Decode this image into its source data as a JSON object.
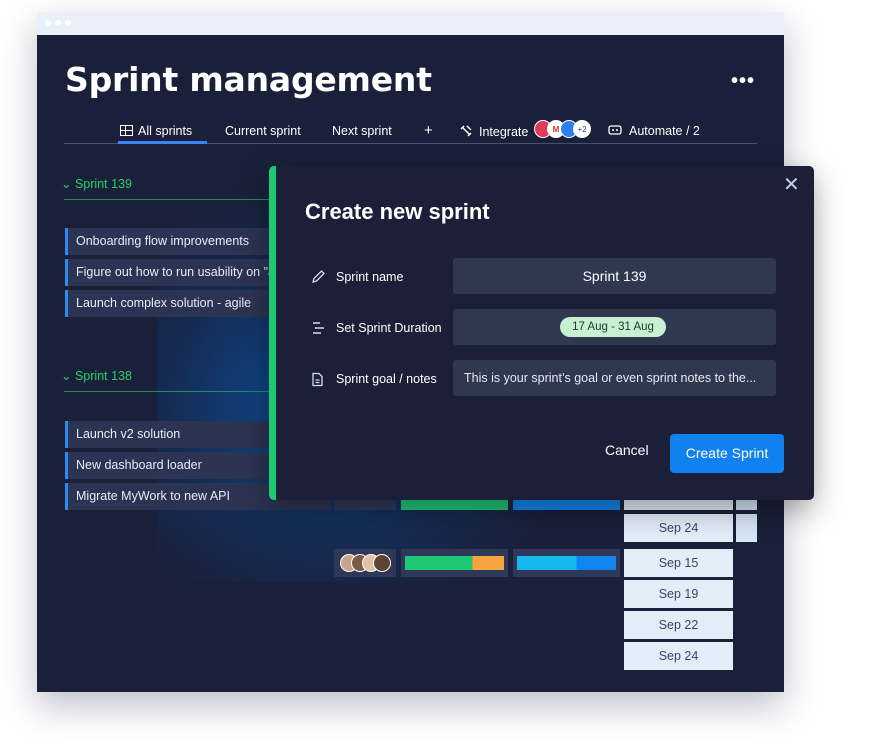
{
  "page": {
    "title": "Sprint management",
    "more_icon": "more-horizontal-icon"
  },
  "tabs": {
    "all_sprints": "All sprints",
    "current_sprint": "Current sprint",
    "next_sprint": "Next sprint",
    "add": "+",
    "integrate": "Integrate",
    "integrate_more": "+2",
    "automate": "Automate / 2"
  },
  "groups": [
    {
      "title": "Sprint 139",
      "color": "#23d06f",
      "tasks": [
        "Onboarding flow improvements",
        "Figure out how to run usability on \"a",
        "Launch complex solution - agile"
      ]
    },
    {
      "title": "Sprint 138",
      "color": "#23d06f",
      "tasks": [
        "Launch v2 solution",
        "New dashboard loader",
        "Migrate MyWork to new API"
      ]
    }
  ],
  "dates_column": {
    "group2_partial": [
      "Sep 24"
    ],
    "group3": [
      "Sep 15",
      "Sep 19",
      "Sep 22",
      "Sep 24"
    ]
  },
  "progress": [
    {
      "status_fill": 0.68,
      "status_colors": [
        "#1ec874",
        "#f7a440"
      ],
      "timeline_fill": 0.6,
      "timeline_colors": [
        "#15b9ee",
        "#1186f0"
      ]
    }
  ],
  "modal": {
    "title": "Create new sprint",
    "fields": {
      "name_label": "Sprint name",
      "name_value": "Sprint 139",
      "duration_label": "Set Sprint Duration",
      "duration_value": "17 Aug - 31 Aug",
      "notes_label": "Sprint goal / notes",
      "notes_value": "This is your sprint’s goal or even sprint notes to the..."
    },
    "cancel_label": "Cancel",
    "create_label": "Create Sprint",
    "accent_color": "#1fc873",
    "button_color": "#1081ef"
  }
}
